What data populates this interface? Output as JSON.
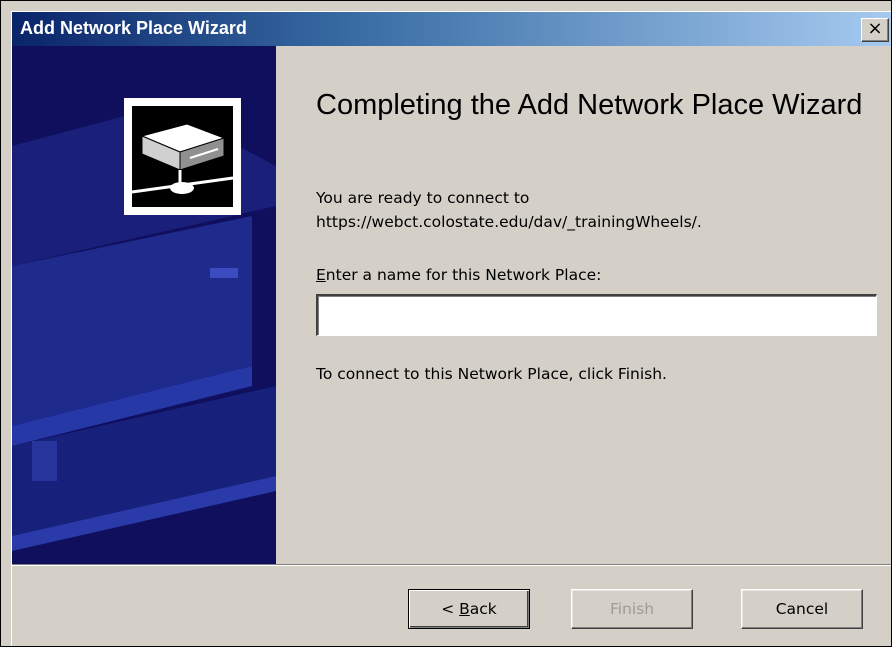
{
  "window": {
    "title": "Add Network Place Wizard",
    "close_glyph": "×"
  },
  "main": {
    "heading": "Completing the Add Network Place Wizard",
    "ready_line1": "You are ready to connect to",
    "ready_url": "https://webct.colostate.edu/dav/_trainingWheels/.",
    "name_label_mnemonic": "E",
    "name_label_rest": "nter a name for this Network Place:",
    "name_value": "",
    "finish_hint": "To connect to this Network Place, click Finish."
  },
  "buttons": {
    "back_prefix": "< ",
    "back_mnemonic": "B",
    "back_rest": "ack",
    "finish": "Finish",
    "cancel": "Cancel",
    "finish_enabled": false
  },
  "icons": {
    "banner": "network-drive-icon",
    "close": "close-icon"
  },
  "colors": {
    "title_start": "#0a246a",
    "title_end": "#a6caf0",
    "banner_bg": "#0f0f5e",
    "dialog_bg": "#d4d0c8",
    "disabled_text": "#a09c94"
  }
}
